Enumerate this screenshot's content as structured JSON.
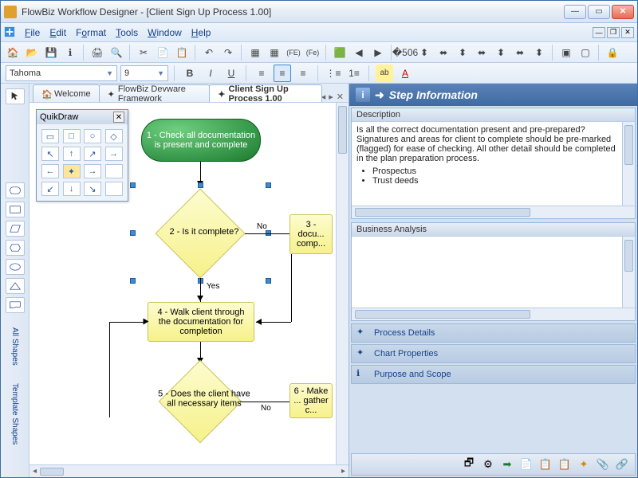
{
  "window": {
    "title": "FlowBiz Workflow Designer - [Client Sign Up Process 1.00]"
  },
  "menu": {
    "file": "File",
    "edit": "Edit",
    "format": "Format",
    "tools": "Tools",
    "window": "Window",
    "help": "Help"
  },
  "font": {
    "family": "Tahoma",
    "size": "9"
  },
  "tabs": {
    "welcome": "Welcome",
    "framework": "FlowBiz Devware Framework",
    "current": "Client Sign Up Process 1.00"
  },
  "quikdraw": {
    "title": "QuikDraw"
  },
  "leftbar": {
    "all_shapes": "All Shapes",
    "template_shapes": "Template Shapes"
  },
  "chart_data": {
    "type": "flowchart",
    "nodes": [
      {
        "id": 1,
        "type": "terminator",
        "text": "1 - Check all documentation is present and complete"
      },
      {
        "id": 2,
        "type": "decision",
        "text": "2 - Is it complete?",
        "selected": true
      },
      {
        "id": 3,
        "type": "process",
        "text": "3 - docu... comp..."
      },
      {
        "id": 4,
        "type": "process",
        "text": "4 - Walk client through the documentation for completion"
      },
      {
        "id": 5,
        "type": "decision",
        "text": "5 - Does the client have all necessary items"
      },
      {
        "id": 6,
        "type": "process",
        "text": "6 - Make ... gather c..."
      }
    ],
    "edges": [
      {
        "from": 1,
        "to": 2
      },
      {
        "from": 2,
        "to": 3,
        "label": "No"
      },
      {
        "from": 2,
        "to": 4,
        "label": "Yes"
      },
      {
        "from": 4,
        "to": 5
      },
      {
        "from": 5,
        "to": 6,
        "label": "No"
      },
      {
        "from": 3,
        "to": 4
      },
      {
        "from": 6,
        "to": 4
      }
    ]
  },
  "labels": {
    "yes": "Yes",
    "no": "No"
  },
  "step_info": {
    "panel_title": "Step Information",
    "description_h": "Description",
    "description": "Is all the correct documentation present and pre-prepared? Signatures and areas for client to complete should be pre-marked (flagged) for ease of checking.  All other detail should be completed in the plan preparation process.",
    "bullet1": "Prospectus",
    "bullet2": "Trust deeds",
    "business_h": "Business Analysis"
  },
  "accordions": {
    "process_details": "Process Details",
    "chart_properties": "Chart Properties",
    "purpose_scope": "Purpose and Scope"
  },
  "icons": {
    "home": "🏠",
    "open": "📂",
    "save": "💾",
    "info": "ℹ",
    "print": "🖨",
    "preview": "🔍",
    "cut": "✂",
    "copy": "📄",
    "paste": "📋",
    "undo": "↶",
    "redo": "↷",
    "grid": "▦",
    "fe": "(FE)",
    "fep": "(Fe)",
    "green": "🟩",
    "back": "◀",
    "fwd": "▶",
    "align_l": "⬌",
    "lock": "🔒",
    "bold": "B",
    "italic": "I",
    "under": "U",
    "al": "≡",
    "ac": "≡",
    "ar": "≡",
    "bull": "•",
    "num": "1.",
    "hl": "ab",
    "fc": "A",
    "gear": "⚙",
    "link": "🔗",
    "clip": "📎"
  }
}
